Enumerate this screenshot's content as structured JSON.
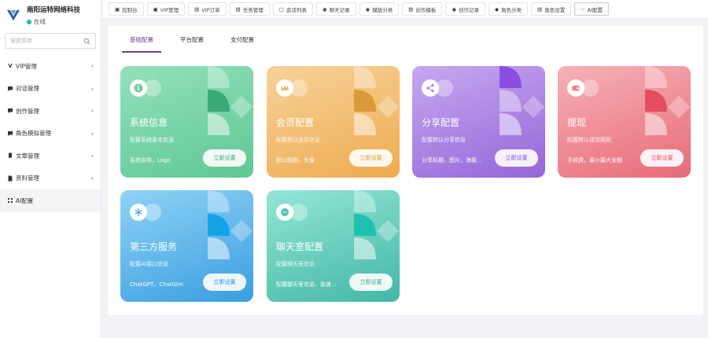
{
  "brand": {
    "name": "南阳运特网络科技",
    "status": "在线"
  },
  "search": {
    "placeholder": "搜索菜单"
  },
  "sidebar": {
    "items": [
      {
        "label": "VIP管理",
        "icon": "v-icon"
      },
      {
        "label": "对话管理",
        "icon": "chat-icon"
      },
      {
        "label": "创作管理",
        "icon": "chat-icon"
      },
      {
        "label": "角色模拟管理",
        "icon": "chat-icon"
      },
      {
        "label": "文章管理",
        "icon": "bookmark-icon"
      },
      {
        "label": "资料管理",
        "icon": "document-icon"
      },
      {
        "label": "AI配置",
        "icon": "settings-icon"
      }
    ]
  },
  "tabs": [
    {
      "label": "控制台",
      "icon": "dashboard-icon"
    },
    {
      "label": "VIP管理",
      "icon": "vip-icon"
    },
    {
      "label": "VIP订单",
      "icon": "document-icon"
    },
    {
      "label": "任务管理",
      "icon": "document-icon"
    },
    {
      "label": "会话列表",
      "icon": "document-icon"
    },
    {
      "label": "聊天记录",
      "icon": "chat-icon"
    },
    {
      "label": "模版分类",
      "icon": "chat-icon"
    },
    {
      "label": "创作模板",
      "icon": "document-icon"
    },
    {
      "label": "创作记录",
      "icon": "chat-icon"
    },
    {
      "label": "角色分类",
      "icon": "tag-icon"
    },
    {
      "label": "角色设置",
      "icon": "document-icon"
    },
    {
      "label": "AI配置",
      "icon": "settings-icon"
    }
  ],
  "subtabs": [
    "基础配置",
    "平台配置",
    "支付配置"
  ],
  "cards": [
    {
      "title": "系统信息",
      "desc": "配置系统基本信息",
      "detail": "系统名称，Logo",
      "button": "立即设置",
      "icon": "info-icon",
      "color": "#6fcf9f"
    },
    {
      "title": "会员配置",
      "desc": "配置默认会员信息",
      "detail": "默认昵称，头像",
      "button": "立即设置",
      "icon": "crown-icon",
      "color": "#f0b560"
    },
    {
      "title": "分享配置",
      "desc": "配置默认分享信息",
      "detail": "分享标题，图片，海报...",
      "button": "立即设置",
      "icon": "share-icon",
      "color": "#a27be0"
    },
    {
      "title": "提现",
      "desc": "配置默认提现规则",
      "detail": "手续费，最小最大金额",
      "button": "立即设置",
      "icon": "wallet-icon",
      "color": "#ee7b86"
    },
    {
      "title": "第三方服务",
      "desc": "配置AI接口信息",
      "detail": "ChatGPT、ChatGlm",
      "button": "立即设置",
      "icon": "snowflake-icon",
      "color": "#3fa4e6"
    },
    {
      "title": "聊天室配置",
      "desc": "配置聊天室信息",
      "detail": "配置聊天室信息，急速...",
      "button": "立即设置",
      "icon": "chat-bubble-icon",
      "color": "#4cc4b3"
    }
  ]
}
